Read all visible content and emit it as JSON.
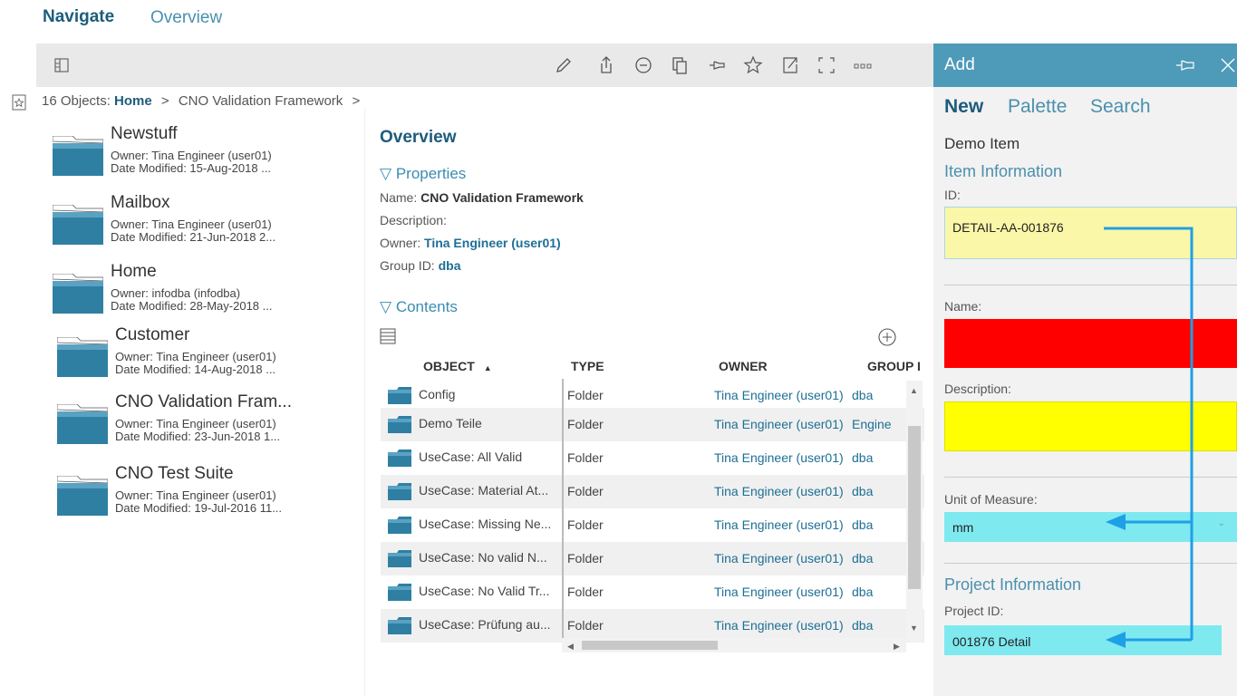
{
  "header": {
    "title": "Navigate",
    "subtitle": "Overview"
  },
  "breadcrumb": {
    "count": "16 Objects:",
    "home": "Home",
    "sep1": ">",
    "current": "CNO Validation Framework",
    "sep2": ">"
  },
  "tiles": [
    {
      "name": "Newstuff",
      "owner": "Owner: Tina Engineer (user01)",
      "date": "Date Modified: 15-Aug-2018 ..."
    },
    {
      "name": "Mailbox",
      "owner": "Owner: Tina Engineer (user01)",
      "date": "Date Modified: 21-Jun-2018 2..."
    },
    {
      "name": "Home",
      "owner": "Owner: infodba (infodba)",
      "date": "Date Modified: 28-May-2018 ..."
    },
    {
      "name": "Customer",
      "owner": "Owner: Tina Engineer (user01)",
      "date": "Date Modified: 14-Aug-2018 ..."
    },
    {
      "name": "CNO Validation Fram...",
      "owner": "Owner: Tina Engineer (user01)",
      "date": "Date Modified: 23-Jun-2018 1..."
    },
    {
      "name": "CNO Test Suite",
      "owner": "Owner: Tina Engineer (user01)",
      "date": "Date Modified: 19-Jul-2016 11..."
    }
  ],
  "overview": {
    "title": "Overview",
    "properties_head": "Properties",
    "name_label": "Name:",
    "name_value": "CNO Validation Framework",
    "desc_label": "Description:",
    "owner_label": "Owner:",
    "owner_value": "Tina Engineer (user01)",
    "group_label": "Group ID:",
    "group_value": "dba",
    "contents_head": "Contents"
  },
  "table": {
    "headers": {
      "object": "OBJECT",
      "sort": "▲",
      "type": "TYPE",
      "owner": "OWNER",
      "group": "GROUP I"
    },
    "rows": [
      {
        "object": "Config",
        "type": "Folder",
        "owner": "Tina Engineer (user01)",
        "group": "dba"
      },
      {
        "object": "Demo Teile",
        "type": "Folder",
        "owner": "Tina Engineer (user01)",
        "group": "Engine"
      },
      {
        "object": "UseCase: All Valid",
        "type": "Folder",
        "owner": "Tina Engineer (user01)",
        "group": "dba"
      },
      {
        "object": "UseCase: Material At...",
        "type": "Folder",
        "owner": "Tina Engineer (user01)",
        "group": "dba"
      },
      {
        "object": "UseCase: Missing Ne...",
        "type": "Folder",
        "owner": "Tina Engineer (user01)",
        "group": "dba"
      },
      {
        "object": "UseCase: No valid N...",
        "type": "Folder",
        "owner": "Tina Engineer (user01)",
        "group": "dba"
      },
      {
        "object": "UseCase: No Valid Tr...",
        "type": "Folder",
        "owner": "Tina Engineer (user01)",
        "group": "dba"
      },
      {
        "object": "UseCase: Prüfung au...",
        "type": "Folder",
        "owner": "Tina Engineer (user01)",
        "group": "dba"
      }
    ]
  },
  "panel": {
    "title": "Add",
    "tabs": {
      "new": "New",
      "palette": "Palette",
      "search": "Search"
    },
    "item_type": "Demo Item",
    "item_info_head": "Item Information",
    "id_label": "ID:",
    "id_value": "DETAIL-AA-001876",
    "name_label": "Name:",
    "desc_label": "Description:",
    "uom_label": "Unit of Measure:",
    "uom_value": "mm",
    "project_head": "Project Information",
    "project_id_label": "Project ID:",
    "project_id_value": "001876 Detail"
  },
  "colors": {
    "accent": "#4e9ab9",
    "required": "#ff0000",
    "highlight_yellow": "#ffff00",
    "highlight_cyan": "#7fe9f0",
    "arrow": "#1ea0e6"
  },
  "icons": [
    "panel-toggle-icon",
    "edit-icon",
    "share-icon",
    "minus-icon",
    "copy-icon",
    "pin-icon",
    "star-icon",
    "open-icon",
    "fullscreen-icon",
    "more-icon",
    "favorites-icon",
    "list-icon",
    "add-icon",
    "close-icon",
    "folder-icon"
  ]
}
